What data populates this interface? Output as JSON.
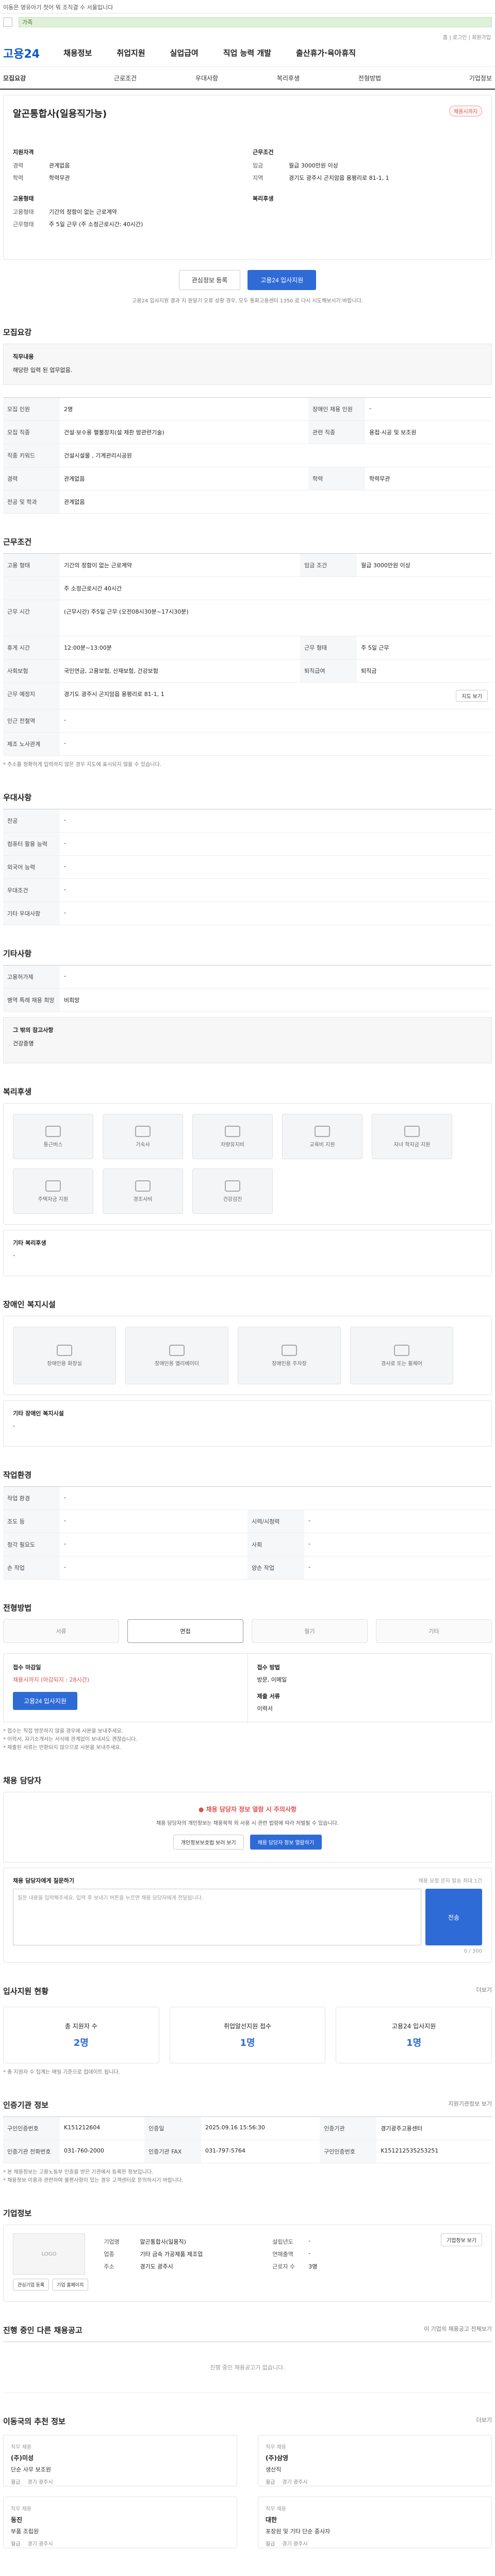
{
  "topbar": {
    "text": "이동은 영유아기 첫어 뭐 조직결 수 서울입니다"
  },
  "greenbar": {
    "text": "가족"
  },
  "rightmini": {
    "text": "홈 | 로그인 | 회원가입"
  },
  "header": {
    "logo": "고용24",
    "nav": [
      "채용정보",
      "취업지원",
      "실업급여",
      "직업 능력 개발",
      "출산휴가·육아휴직"
    ]
  },
  "tabs": [
    "모집요강",
    "근로조건",
    "우대사항",
    "복리후생",
    "전형방법",
    "기업정보"
  ],
  "company": {
    "name": "알곤통합사(일용직가능)",
    "badge": "채용시까지",
    "left_h": "지원자격",
    "left": [
      {
        "k": "경력",
        "v": "관계없음"
      },
      {
        "k": "학력",
        "v": "학력무관"
      }
    ],
    "right_h": "근무조건",
    "right": [
      {
        "k": "임금",
        "v": "월급 3000만원 이상"
      },
      {
        "k": "지역",
        "v": "경기도 광주시 곤지암읍 용평리로 81-1, 1"
      }
    ],
    "left2_h": "고용형태",
    "left2": [
      {
        "k": "고용형태",
        "v": "기간의 정함이 없는 근로계약"
      },
      {
        "k": "근무형태",
        "v": "주 5일 근무 (주 소정근로시간: 40시간)"
      }
    ],
    "right2_h": "복리후생",
    "btn_interest": "관심정보 등록",
    "btn_apply": "고용24 입사지원",
    "note": "고용24 입사지원 결과 지 원알기 오류 상황 경우, 모두 통화고용센터 1350 로 다시 시도해보시기 바랍니다."
  },
  "recruit": {
    "title": "모집요강",
    "desc_h": "직무내용",
    "desc": "해당란 입력 된 업무없음.",
    "rows": [
      {
        "k1": "모집 인원",
        "v1": "2명",
        "k2": "장애인 채용 인원",
        "v2": "-"
      },
      {
        "k1": "모집 직종",
        "v1": "건설·보수용 펼불장치(설 제판 밤관련기술)",
        "k2": "관련 직종",
        "v2": "용접·시공 및 보조원"
      },
      {
        "k1": "직종 키워드",
        "v1": "건설시설물 , 기계관리시공원",
        "k2": "",
        "v2": ""
      },
      {
        "k1": "경력",
        "v1": "관계없음",
        "k2": "학력",
        "v2": "학력무관"
      },
      {
        "k1": "전공 및 학과",
        "v1": "관계없음",
        "k2": "",
        "v2": ""
      }
    ]
  },
  "work": {
    "title": "근무조건",
    "rows": [
      {
        "k1": "고용 형태",
        "v1": "기간의 정함이 없는 근로계약",
        "k2": "임금 조건",
        "v2": "월급 3000만원 이상"
      },
      {
        "k1": "",
        "v1": "주 소정근로시간 40시간",
        "k2": "",
        "v2": ""
      },
      {
        "k1": "근무 시간",
        "v1": "(근무시간) 주5일 근무 (오전08시30분~17시30분)",
        "k2": "",
        "v2": ""
      },
      {
        "k1": "휴게 시간",
        "v1": "12:00분~13:00분",
        "k2": "근무 형태",
        "v2": "주 5일 근무"
      },
      {
        "k1": "사회보험",
        "v1": "국민연금, 고용보험, 산재보험, 건강보험",
        "k2": "퇴직급여",
        "v2": "퇴직금"
      },
      {
        "k1": "근무 예정지",
        "v1": "경기도 광주시 곤지암읍 용평리로 81-1, 1",
        "k2": "",
        "v2": ""
      },
      {
        "k1": "인근 전철역",
        "v1": "-",
        "k2": "",
        "v2": ""
      },
      {
        "k1": "제조 노사관계",
        "v1": "-",
        "k2": "",
        "v2": ""
      }
    ],
    "map_btn": "지도 보기",
    "note": "* 주소를 정확하게 입력하지 않은 경우 지도에 표시되지 않을 수 있습니다."
  },
  "pref": {
    "title": "우대사항",
    "rows": [
      {
        "k": "전공",
        "v": "-"
      },
      {
        "k": "컴퓨터 활용 능력",
        "v": "-"
      },
      {
        "k": "외국어 능력",
        "v": "-"
      },
      {
        "k": "우대조건",
        "v": "-"
      },
      {
        "k": "기타 우대사항",
        "v": "-"
      }
    ]
  },
  "etc": {
    "title": "기타사항",
    "rows": [
      {
        "k": "고용허가제",
        "v": "-"
      },
      {
        "k": "병역 특례 채용 희망",
        "v": "비희망"
      }
    ],
    "box_h": "그 밖의 참고사항",
    "box": "건강증명"
  },
  "welfare": {
    "title": "복리후생",
    "icons": [
      "통근버스",
      "기숙사",
      "차량유지비",
      "교육비 지원",
      "자녀 학자금 지원",
      "주택자금 지원",
      "경조사비",
      "건강검진"
    ],
    "other_h": "기타 복리후생",
    "other": "-"
  },
  "disabled": {
    "title": "장애인 복지시설",
    "icons": [
      "장애인용 화장실",
      "장애인용 엘리베이터",
      "장애인용 주차장",
      "경사로 또는 휠체어"
    ],
    "other_h": "기타 장애인 복지시설",
    "other": "-"
  },
  "workenv": {
    "title": "작업환경",
    "rows": [
      {
        "k1": "작업 환경",
        "v1": "-",
        "k2": "",
        "v2": ""
      },
      {
        "k1": "조도 등",
        "v1": "-",
        "k2": "시력/시청력",
        "v2": "-"
      },
      {
        "k1": "청각 필요도",
        "v1": "-",
        "k2": "사회",
        "v2": "-"
      },
      {
        "k1": "손 작업",
        "v1": "-",
        "k2": "양손 작업",
        "v2": "-"
      }
    ]
  },
  "screening": {
    "title": "전형방법",
    "steps": [
      "서류",
      "면접",
      "필기",
      "기타"
    ],
    "active": 1,
    "left_h": "접수 마감일",
    "left_v": "채용시까지 (마감되지 : 28시간)",
    "apply_btn": "고용24 입사지원",
    "right_h1": "접수 방법",
    "right_v1": "방문, 이메일",
    "right_h2": "제출 서류",
    "right_v2": "이력서",
    "notes": [
      "* 접수는 직접 방문하지 않을 경우에 사본을 보내주세요.",
      "* 이력서, 자기소개서는 서식에 관계없이 보내셔도 괜찮습니다.",
      "* 제출된 서류는 반환되지 않으므로 사본을 보내주세요."
    ]
  },
  "manager": {
    "title": "채용 담당자",
    "alert": "채용 담당자 정보 열람 시 주의사항",
    "alert_body": "채용 담당자의 개인정보는 채용목적 외 사용 시 관련 법령에 따라 처벌될 수 있습니다.",
    "btn1": "개인정보보호법 보러 보기",
    "btn2": "채용 담당자 정보 열람하기",
    "inq_h": "채용 담당자에게 질문하기",
    "inq_note": "채용 요청 문자 발송 최대 1건",
    "placeholder": "질문 내용을 입력해주세요. 입력 후 보내기 버튼을 누르면 채용 담당자에게 전달됩니다.",
    "counter": "0 / 300",
    "send": "전송"
  },
  "applicants": {
    "title": "입사지원 현황",
    "more": "더보기",
    "stats": [
      {
        "label": "총 지원자 수",
        "value": "2명"
      },
      {
        "label": "취업알선지원 접수",
        "value": "1명"
      },
      {
        "label": "고용24 입사지원",
        "value": "1명"
      }
    ],
    "note": "* 총 지원자 수 집계는 매일 기준으로 업데이트 됩니다."
  },
  "agency": {
    "title": "인증기관 정보",
    "more": "지원기관정보 보기",
    "rows": [
      {
        "k1": "구인인증번호",
        "v1": "K151212604",
        "k2": "인증일",
        "v2": "2025.09.16 15:56:30",
        "k3": "인증기관",
        "v3": "경기광주고용센터"
      },
      {
        "k1": "인증기관 전화번호",
        "v1": "031-760-2000",
        "k2": "인증기관 FAX",
        "v2": "031-797-5764",
        "k3": "구인인증번호",
        "v3": "K151212535253251"
      }
    ],
    "notes": [
      "* 본 채용정보는 고용노동부 인증을 받은 기관에서 등록한 정보입니다.",
      "* 채용정보 이용과 관련하여 불편사항이 있는 경우 고객센터로 문의하시기 바랍니다."
    ]
  },
  "company_info": {
    "title": "기업정보",
    "logo_txt": "LOGO",
    "btn1": "관심기업 등록",
    "btn2": "기업 홈페이지",
    "rows": [
      {
        "k": "기업명",
        "v": "알곤통합사(일용직)"
      },
      {
        "k": "업종",
        "v": "기타 금속 가공제품 제조업"
      },
      {
        "k": "주소",
        "v": "경기도 광주시"
      }
    ],
    "rows2": [
      {
        "k": "설립년도",
        "v": "-"
      },
      {
        "k": "연매출액",
        "v": "-"
      },
      {
        "k": "근로자 수",
        "v": "3명"
      }
    ],
    "more": "기업정보 보기"
  },
  "other_jobs": {
    "title": "진행 중인 다른 채용공고",
    "more": "이 기업의 채용공고 전체보기",
    "empty": "진행 중인 채용공고가 없습니다."
  },
  "recommend": {
    "title": "이동국의 추천 정보",
    "more": "더보기",
    "left": [
      {
        "tag": "직무 채용",
        "co": "(주)미성",
        "t": "단순 사무 보조원",
        "m1": "월급",
        "m2": "경기 광주시"
      },
      {
        "tag": "직무 채용",
        "co": "동진",
        "t": "부품 조립원",
        "m1": "월급",
        "m2": "경기 광주시"
      }
    ],
    "right": [
      {
        "tag": "직무 채용",
        "co": "(주)삼영",
        "t": "생산직",
        "m1": "월급",
        "m2": "경기 광주시"
      },
      {
        "tag": "직무 채용",
        "co": "대한",
        "t": "포장원 및 기타 단순 종사자",
        "m1": "월급",
        "m2": "경기 광주시"
      }
    ]
  }
}
